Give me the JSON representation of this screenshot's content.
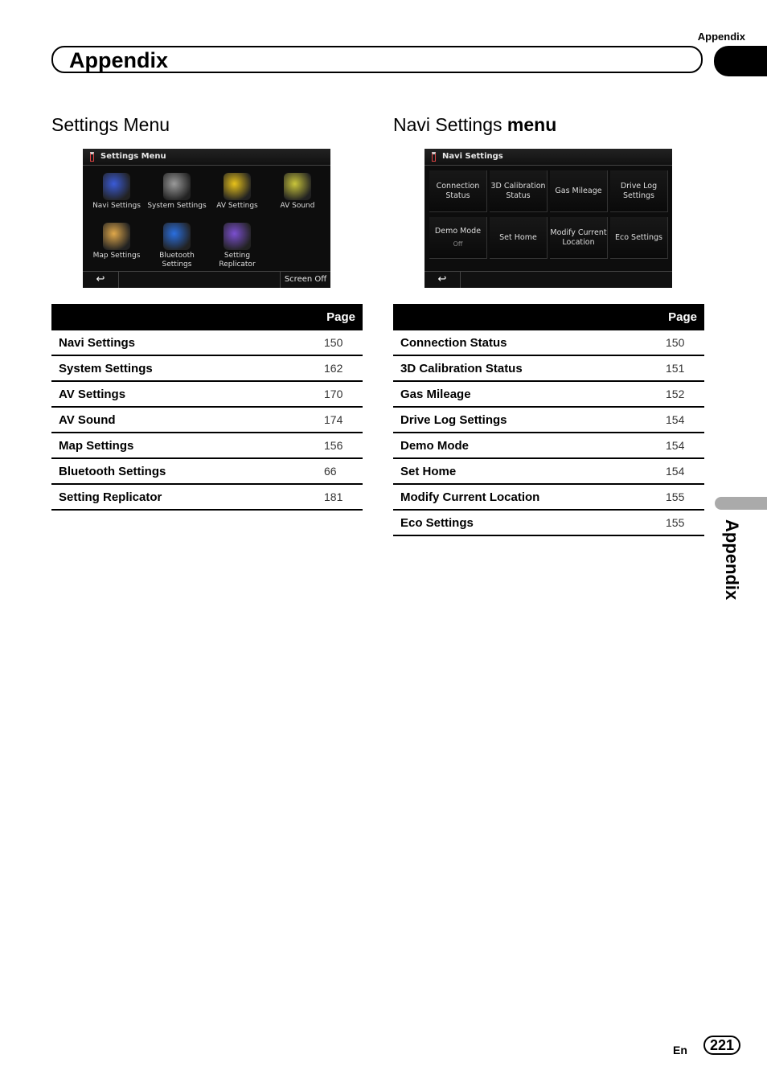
{
  "running_head": "Appendix",
  "chapter_title": "Appendix",
  "side_tab_label": "Appendix",
  "footer": {
    "lang": "En",
    "page": "221"
  },
  "left": {
    "heading": "Settings Menu",
    "screen": {
      "title": "Settings Menu",
      "icons": [
        {
          "label": "Navi Settings",
          "icon": "checkered-flag-icon"
        },
        {
          "label": "System Settings",
          "icon": "gears-icon"
        },
        {
          "label": "AV Settings",
          "icon": "music-note-icon"
        },
        {
          "label": "AV Sound",
          "icon": "speaker-icon"
        },
        {
          "label": "Map Settings",
          "icon": "map-icon"
        },
        {
          "label": "Bluetooth Settings",
          "icon": "bluetooth-icon"
        },
        {
          "label": "Setting Replicator",
          "icon": "replicator-icon"
        }
      ],
      "back": "↩",
      "screen_off": "Screen Off"
    },
    "table": {
      "header": "Page",
      "rows": [
        {
          "label": "Navi Settings",
          "page": "150"
        },
        {
          "label": "System Settings",
          "page": "162"
        },
        {
          "label": "AV Settings",
          "page": "170"
        },
        {
          "label": "AV Sound",
          "page": "174"
        },
        {
          "label": "Map Settings",
          "page": "156"
        },
        {
          "label": "Bluetooth Settings",
          "page": "66"
        },
        {
          "label": "Setting Replicator",
          "page": "181"
        }
      ]
    }
  },
  "right": {
    "heading_normal": "Navi Settings ",
    "heading_bold": "menu",
    "screen": {
      "title": "Navi Settings",
      "buttons": [
        {
          "label": "Connection Status",
          "sub": ""
        },
        {
          "label": "3D Calibration Status",
          "sub": ""
        },
        {
          "label": "Gas Mileage",
          "sub": ""
        },
        {
          "label": "Drive Log Settings",
          "sub": ""
        },
        {
          "label": "Demo Mode",
          "sub": "Off"
        },
        {
          "label": "Set Home",
          "sub": ""
        },
        {
          "label": "Modify Current Location",
          "sub": ""
        },
        {
          "label": "Eco Settings",
          "sub": ""
        }
      ],
      "back": "↩"
    },
    "table": {
      "header": "Page",
      "rows": [
        {
          "label": "Connection Status",
          "page": "150"
        },
        {
          "label": "3D Calibration Status",
          "page": "151"
        },
        {
          "label": "Gas Mileage",
          "page": "152"
        },
        {
          "label": "Drive Log Settings",
          "page": "154"
        },
        {
          "label": "Demo Mode",
          "page": "154"
        },
        {
          "label": "Set Home",
          "page": "154"
        },
        {
          "label": "Modify Current Location",
          "page": "155"
        },
        {
          "label": "Eco Settings",
          "page": "155"
        }
      ]
    }
  }
}
